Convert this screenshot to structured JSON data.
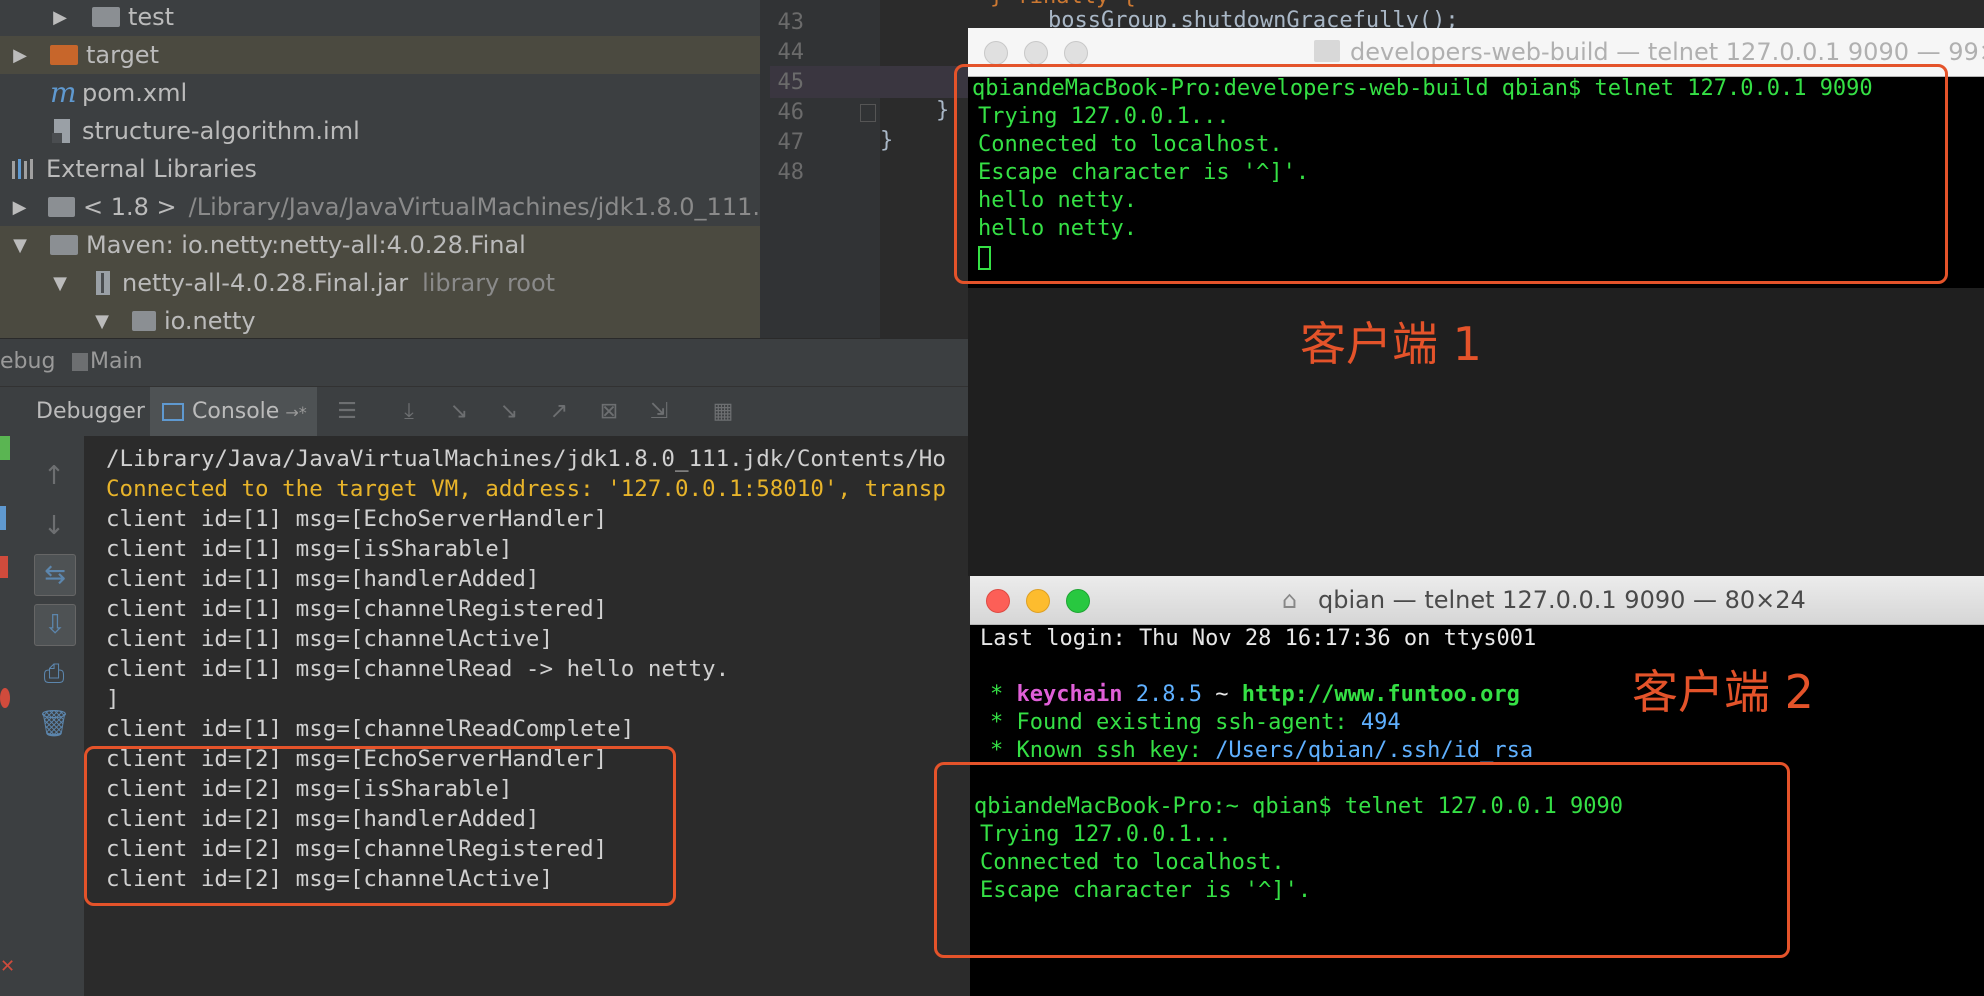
{
  "project_tree": {
    "items": [
      {
        "label": "test",
        "icon": "folder-icon"
      },
      {
        "label": "target",
        "icon": "folder-icon"
      },
      {
        "label": "pom.xml",
        "icon": "maven-icon"
      },
      {
        "label": "structure-algorithm.iml",
        "icon": "iml-file-icon"
      },
      {
        "label": "External Libraries",
        "icon": "libraries-icon"
      },
      {
        "label": "< 1.8 >",
        "detail": "/Library/Java/JavaVirtualMachines/jdk1.8.0_111.",
        "icon": "jdk-icon"
      },
      {
        "label": "Maven: io.netty:netty-all:4.0.28.Final",
        "icon": "library-icon"
      },
      {
        "label": "netty-all-4.0.28.Final.jar",
        "detail": "library root",
        "icon": "jar-icon"
      },
      {
        "label": "io.netty",
        "icon": "package-icon"
      }
    ]
  },
  "editor": {
    "line_numbers": [
      "43",
      "44",
      "45",
      "46",
      "47",
      "48"
    ],
    "lines": {
      "l42": "} finally {",
      "l43": "bossGroup.shutdownGracefully();",
      "l46": "}",
      "l47": "}"
    }
  },
  "debug": {
    "header_left": "ebug",
    "header_run": "Main",
    "tabs": {
      "debugger": "Debugger",
      "console": "Console"
    },
    "console_lines": [
      "/Library/Java/JavaVirtualMachines/jdk1.8.0_111.jdk/Contents/Ho",
      "Connected to the target VM, address: '127.0.0.1:58010', transp",
      "client id=[1] msg=[EchoServerHandler]",
      "client id=[1] msg=[isSharable]",
      "client id=[1] msg=[handlerAdded]",
      "client id=[1] msg=[channelRegistered]",
      "client id=[1] msg=[channelActive]",
      "client id=[1] msg=[channelRead -> hello netty.",
      "]",
      "client id=[1] msg=[channelReadComplete]",
      "client id=[2] msg=[EchoServerHandler]",
      "client id=[2] msg=[isSharable]",
      "client id=[2] msg=[handlerAdded]",
      "client id=[2] msg=[channelRegistered]",
      "client id=[2] msg=[channelActive]"
    ]
  },
  "terminal1": {
    "title": "developers-web-build — telnet 127.0.0.1 9090 — 99×",
    "lines": [
      "qbiandeMacBook-Pro:developers-web-build qbian$ telnet 127.0.0.1 9090",
      "Trying 127.0.0.1...",
      "Connected to localhost.",
      "Escape character is '^]'.",
      "hello netty.",
      "hello netty."
    ],
    "annotation": "客户端 1"
  },
  "terminal2": {
    "title": "qbian — telnet 127.0.0.1 9090 — 80×24",
    "last_login": "Last login: Thu Nov 28 16:17:36 on ttys001",
    "keychain_name": "keychain",
    "keychain_version": "2.8.5",
    "keychain_sep": "~",
    "keychain_url": "http://www.funtoo.org",
    "found_agent_text": "Found existing ssh-agent: ",
    "found_agent_pid": "494",
    "known_key_text": "Known ssh key: ",
    "known_key_path": "/Users/qbian/.ssh/id_rsa",
    "lines": [
      "qbiandeMacBook-Pro:~ qbian$ telnet 127.0.0.1 9090",
      "Trying 127.0.0.1...",
      "Connected to localhost.",
      "Escape character is '^]'."
    ],
    "annotation": "客户端 2"
  },
  "colors": {
    "annotation_red": "#e4532a",
    "terminal_green": "#35e045",
    "console_yellow": "#e8b42a"
  }
}
